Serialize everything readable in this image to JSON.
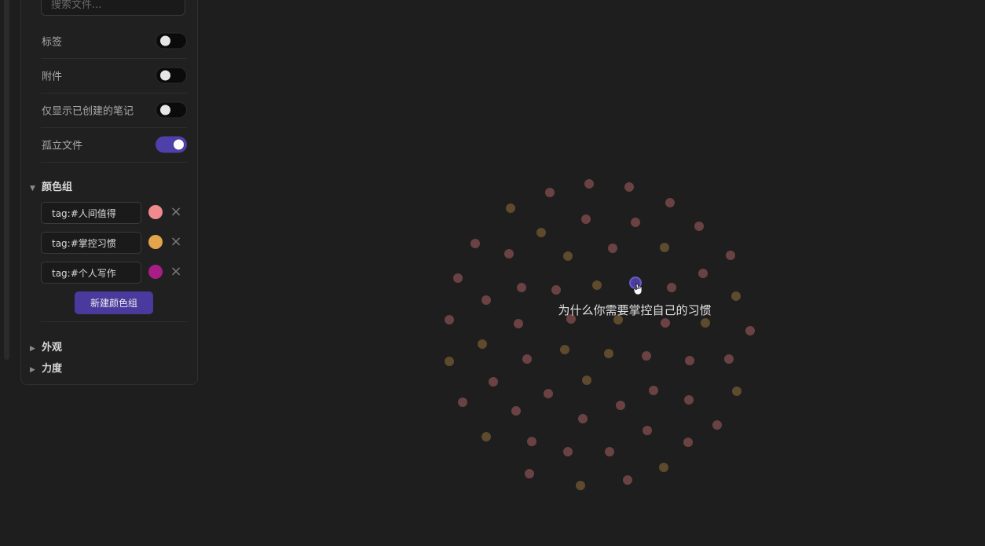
{
  "filters": {
    "search_placeholder": "搜索文件...",
    "rows": [
      {
        "label": "标签",
        "on": false
      },
      {
        "label": "附件",
        "on": false
      },
      {
        "label": "仅显示已创建的笔记",
        "on": false
      },
      {
        "label": "孤立文件",
        "on": true
      }
    ]
  },
  "groups": {
    "title": "颜色组",
    "items": [
      {
        "query": "tag:#人间值得",
        "color": "#f08a8c"
      },
      {
        "query": "tag:#掌控习惯",
        "color": "#e3a44b"
      },
      {
        "query": "tag:#个人写作",
        "color": "#a81e86"
      }
    ],
    "new_label": "新建颜色组"
  },
  "sections": {
    "appearance": "外观",
    "forces": "力度"
  },
  "graph": {
    "highlighted_node_label": "为什么你需要掌控自己的习惯",
    "highlight_color": "#4a3d9c",
    "node_colors": {
      "pink": "#6b4243",
      "gold": "#5e4a2c"
    }
  }
}
